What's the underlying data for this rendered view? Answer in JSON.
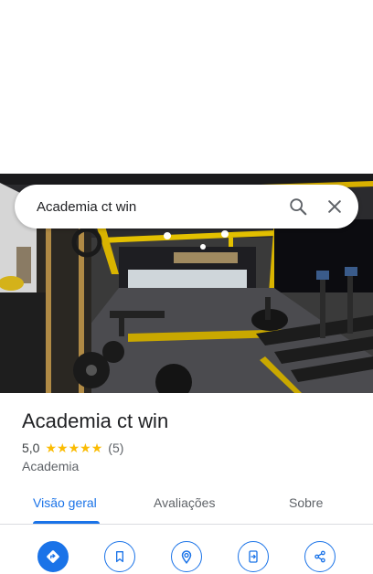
{
  "search": {
    "query": "Academia ct win",
    "search_icon": "search-icon",
    "close_icon": "close-icon"
  },
  "place": {
    "name": "Academia ct win",
    "rating": "5,0",
    "stars": 5,
    "reviews": "(5)",
    "category": "Academia"
  },
  "tabs": [
    {
      "label": "Visão geral",
      "active": true
    },
    {
      "label": "Avaliações",
      "active": false
    },
    {
      "label": "Sobre",
      "active": false
    }
  ],
  "actions": [
    {
      "icon": "directions-icon"
    },
    {
      "icon": "bookmark-icon"
    },
    {
      "icon": "nearby-icon"
    },
    {
      "icon": "send-to-phone-icon"
    },
    {
      "icon": "share-icon"
    }
  ],
  "colors": {
    "accent": "#1a73e8",
    "star": "#fbbc04",
    "text_primary": "#202124",
    "text_secondary": "#5f6368"
  }
}
